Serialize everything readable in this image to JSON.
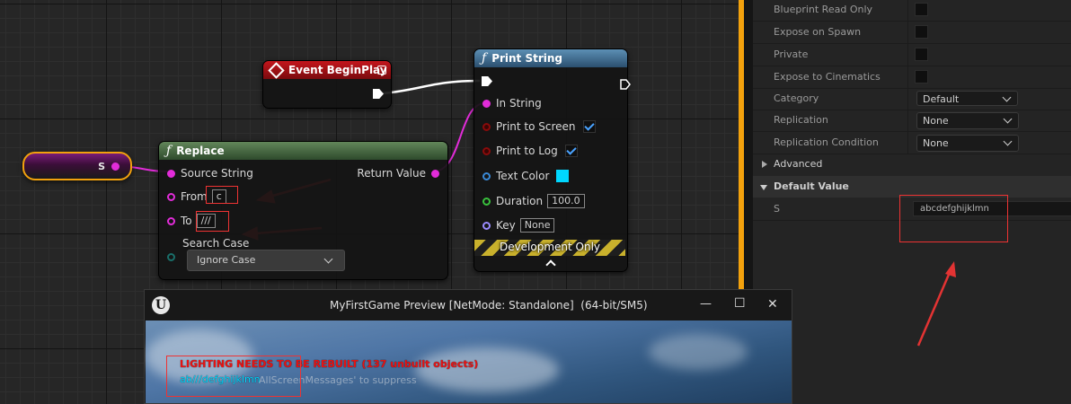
{
  "graph": {
    "variable_node": {
      "pin_label": "S"
    },
    "event_node": {
      "title": "Event BeginPlay"
    },
    "replace_node": {
      "title": "Replace",
      "inputs": {
        "source": "Source String",
        "from": "From",
        "from_value": "c",
        "to": "To",
        "to_value": "///",
        "search_case": "Search Case",
        "search_case_value": "Ignore Case"
      },
      "outputs": {
        "return": "Return Value"
      }
    },
    "print_node": {
      "title": "Print String",
      "in_string": "In String",
      "print_to_screen": "Print to Screen",
      "print_to_log": "Print to Log",
      "text_color": "Text Color",
      "duration": "Duration",
      "duration_value": "100.0",
      "key": "Key",
      "key_value": "None",
      "footer": "Development Only"
    }
  },
  "details": {
    "rows": [
      {
        "label": "Blueprint Read Only"
      },
      {
        "label": "Expose on Spawn"
      },
      {
        "label": "Private"
      },
      {
        "label": "Expose to Cinematics"
      }
    ],
    "category": {
      "label": "Category",
      "value": "Default"
    },
    "replication": {
      "label": "Replication",
      "value": "None"
    },
    "replication_condition": {
      "label": "Replication Condition",
      "value": "None"
    },
    "advanced": "Advanced",
    "default_value_section": "Default Value",
    "default_value": {
      "label": "S",
      "value": "abcdefghijklmn"
    }
  },
  "preview": {
    "title": "MyFirstGame Preview [NetMode: Standalone]  (64-bit/SM5)",
    "logo": "U",
    "minimize": "—",
    "maximize": "☐",
    "close": "✕",
    "lighting_message": "LIGHTING NEEDS TO BE REBUILT (137 unbuilt objects)",
    "output_text": "ab///defghijklmn",
    "suppress_hint": "AllScreenMessages' to suppress"
  },
  "colors": {
    "accent": "#f2a10d",
    "annotation": "#e33333",
    "string_pin": "#e22cd9",
    "print_text": "#00d7ff"
  }
}
